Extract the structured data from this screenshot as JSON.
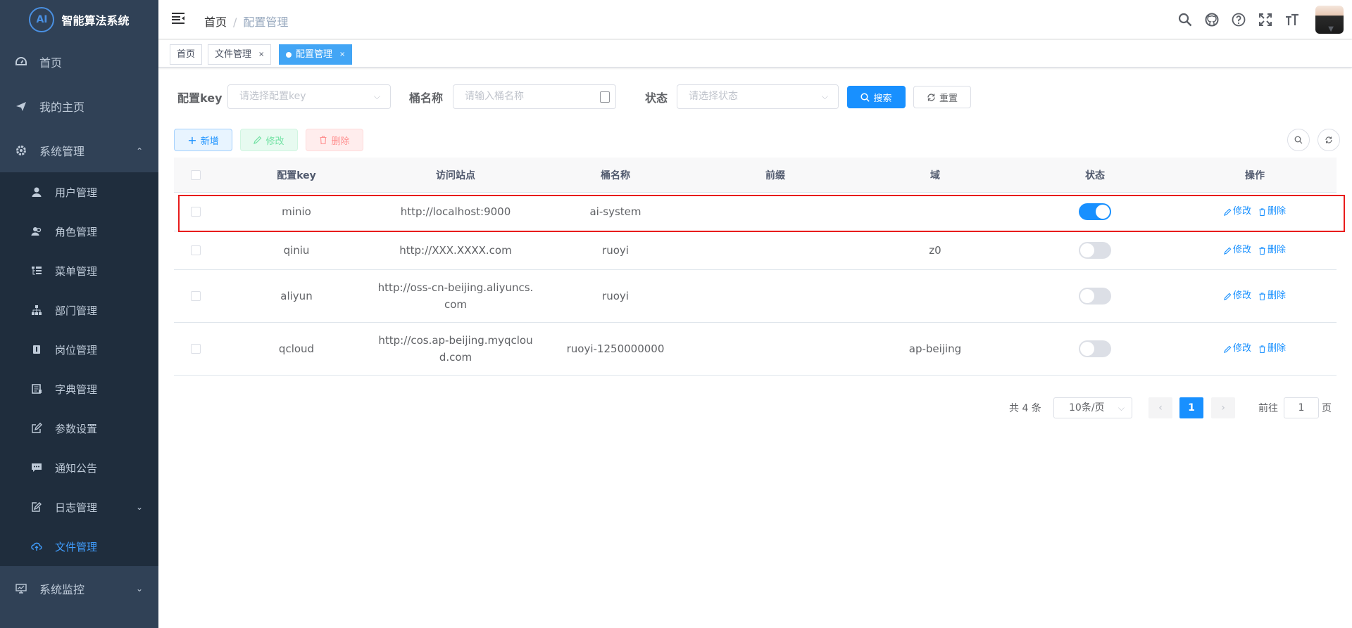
{
  "app": {
    "title": "智能算法系统",
    "logo_text": "AI"
  },
  "sidebar": {
    "items": [
      {
        "label": "首页",
        "icon": "dashboard-icon"
      },
      {
        "label": "我的主页",
        "icon": "send-icon"
      },
      {
        "label": "系统管理",
        "icon": "gear-icon",
        "expanded": true
      },
      {
        "label": "系统监控",
        "icon": "monitor-icon",
        "expanded": false
      }
    ],
    "sub_items": [
      {
        "label": "用户管理",
        "icon": "user-icon"
      },
      {
        "label": "角色管理",
        "icon": "peoples-icon"
      },
      {
        "label": "菜单管理",
        "icon": "tree-table-icon"
      },
      {
        "label": "部门管理",
        "icon": "tree-icon"
      },
      {
        "label": "岗位管理",
        "icon": "post-icon"
      },
      {
        "label": "字典管理",
        "icon": "dict-icon"
      },
      {
        "label": "参数设置",
        "icon": "edit-icon"
      },
      {
        "label": "通知公告",
        "icon": "message-icon"
      },
      {
        "label": "日志管理",
        "icon": "log-icon",
        "expanded": false
      },
      {
        "label": "文件管理",
        "icon": "upload-cloud-icon",
        "active": true
      }
    ]
  },
  "navbar": {
    "breadcrumb": [
      "首页",
      "配置管理"
    ],
    "separator": "/",
    "tools": [
      "search-icon",
      "github-icon",
      "question-icon",
      "fullscreen-icon",
      "font-size-icon"
    ]
  },
  "tags": [
    {
      "label": "首页",
      "closable": false,
      "active": false
    },
    {
      "label": "文件管理",
      "closable": true,
      "active": false
    },
    {
      "label": "配置管理",
      "closable": true,
      "active": true
    }
  ],
  "tag_close_glyph": "×",
  "search": {
    "config_key_label": "配置key",
    "config_key_placeholder": "请选择配置key",
    "bucket_label": "桶名称",
    "bucket_placeholder": "请输入桶名称",
    "status_label": "状态",
    "status_placeholder": "请选择状态",
    "search_button": "搜索",
    "reset_button": "重置"
  },
  "toolbar": {
    "add": "新增",
    "edit": "修改",
    "delete": "删除"
  },
  "table": {
    "columns": [
      "配置key",
      "访问站点",
      "桶名称",
      "前缀",
      "域",
      "状态",
      "操作"
    ],
    "rows": [
      {
        "key": "minio",
        "site": "http://localhost:9000",
        "site2": "",
        "bucket": "ai-system",
        "prefix": "",
        "domain": "",
        "status": true
      },
      {
        "key": "qiniu",
        "site": "http://XXX.XXXX.com",
        "site2": "",
        "bucket": "ruoyi",
        "prefix": "",
        "domain": "z0",
        "status": false
      },
      {
        "key": "aliyun",
        "site": "http://oss-cn-beijing.aliyuncs.",
        "site2": "com",
        "bucket": "ruoyi",
        "prefix": "",
        "domain": "",
        "status": false
      },
      {
        "key": "qcloud",
        "site": "http://cos.ap-beijing.myqclou",
        "site2": "d.com",
        "bucket": "ruoyi-1250000000",
        "prefix": "",
        "domain": "ap-beijing",
        "status": false
      }
    ],
    "op_edit": "修改",
    "op_delete": "删除"
  },
  "pagination": {
    "total_text": "共 4 条",
    "page_size": "10条/页",
    "current_page": "1",
    "goto_label": "前往",
    "goto_value": "1",
    "page_suffix": "页"
  },
  "colors": {
    "primary": "#1890ff",
    "sidebar_bg": "#304156",
    "highlight": "#e81c1c"
  }
}
